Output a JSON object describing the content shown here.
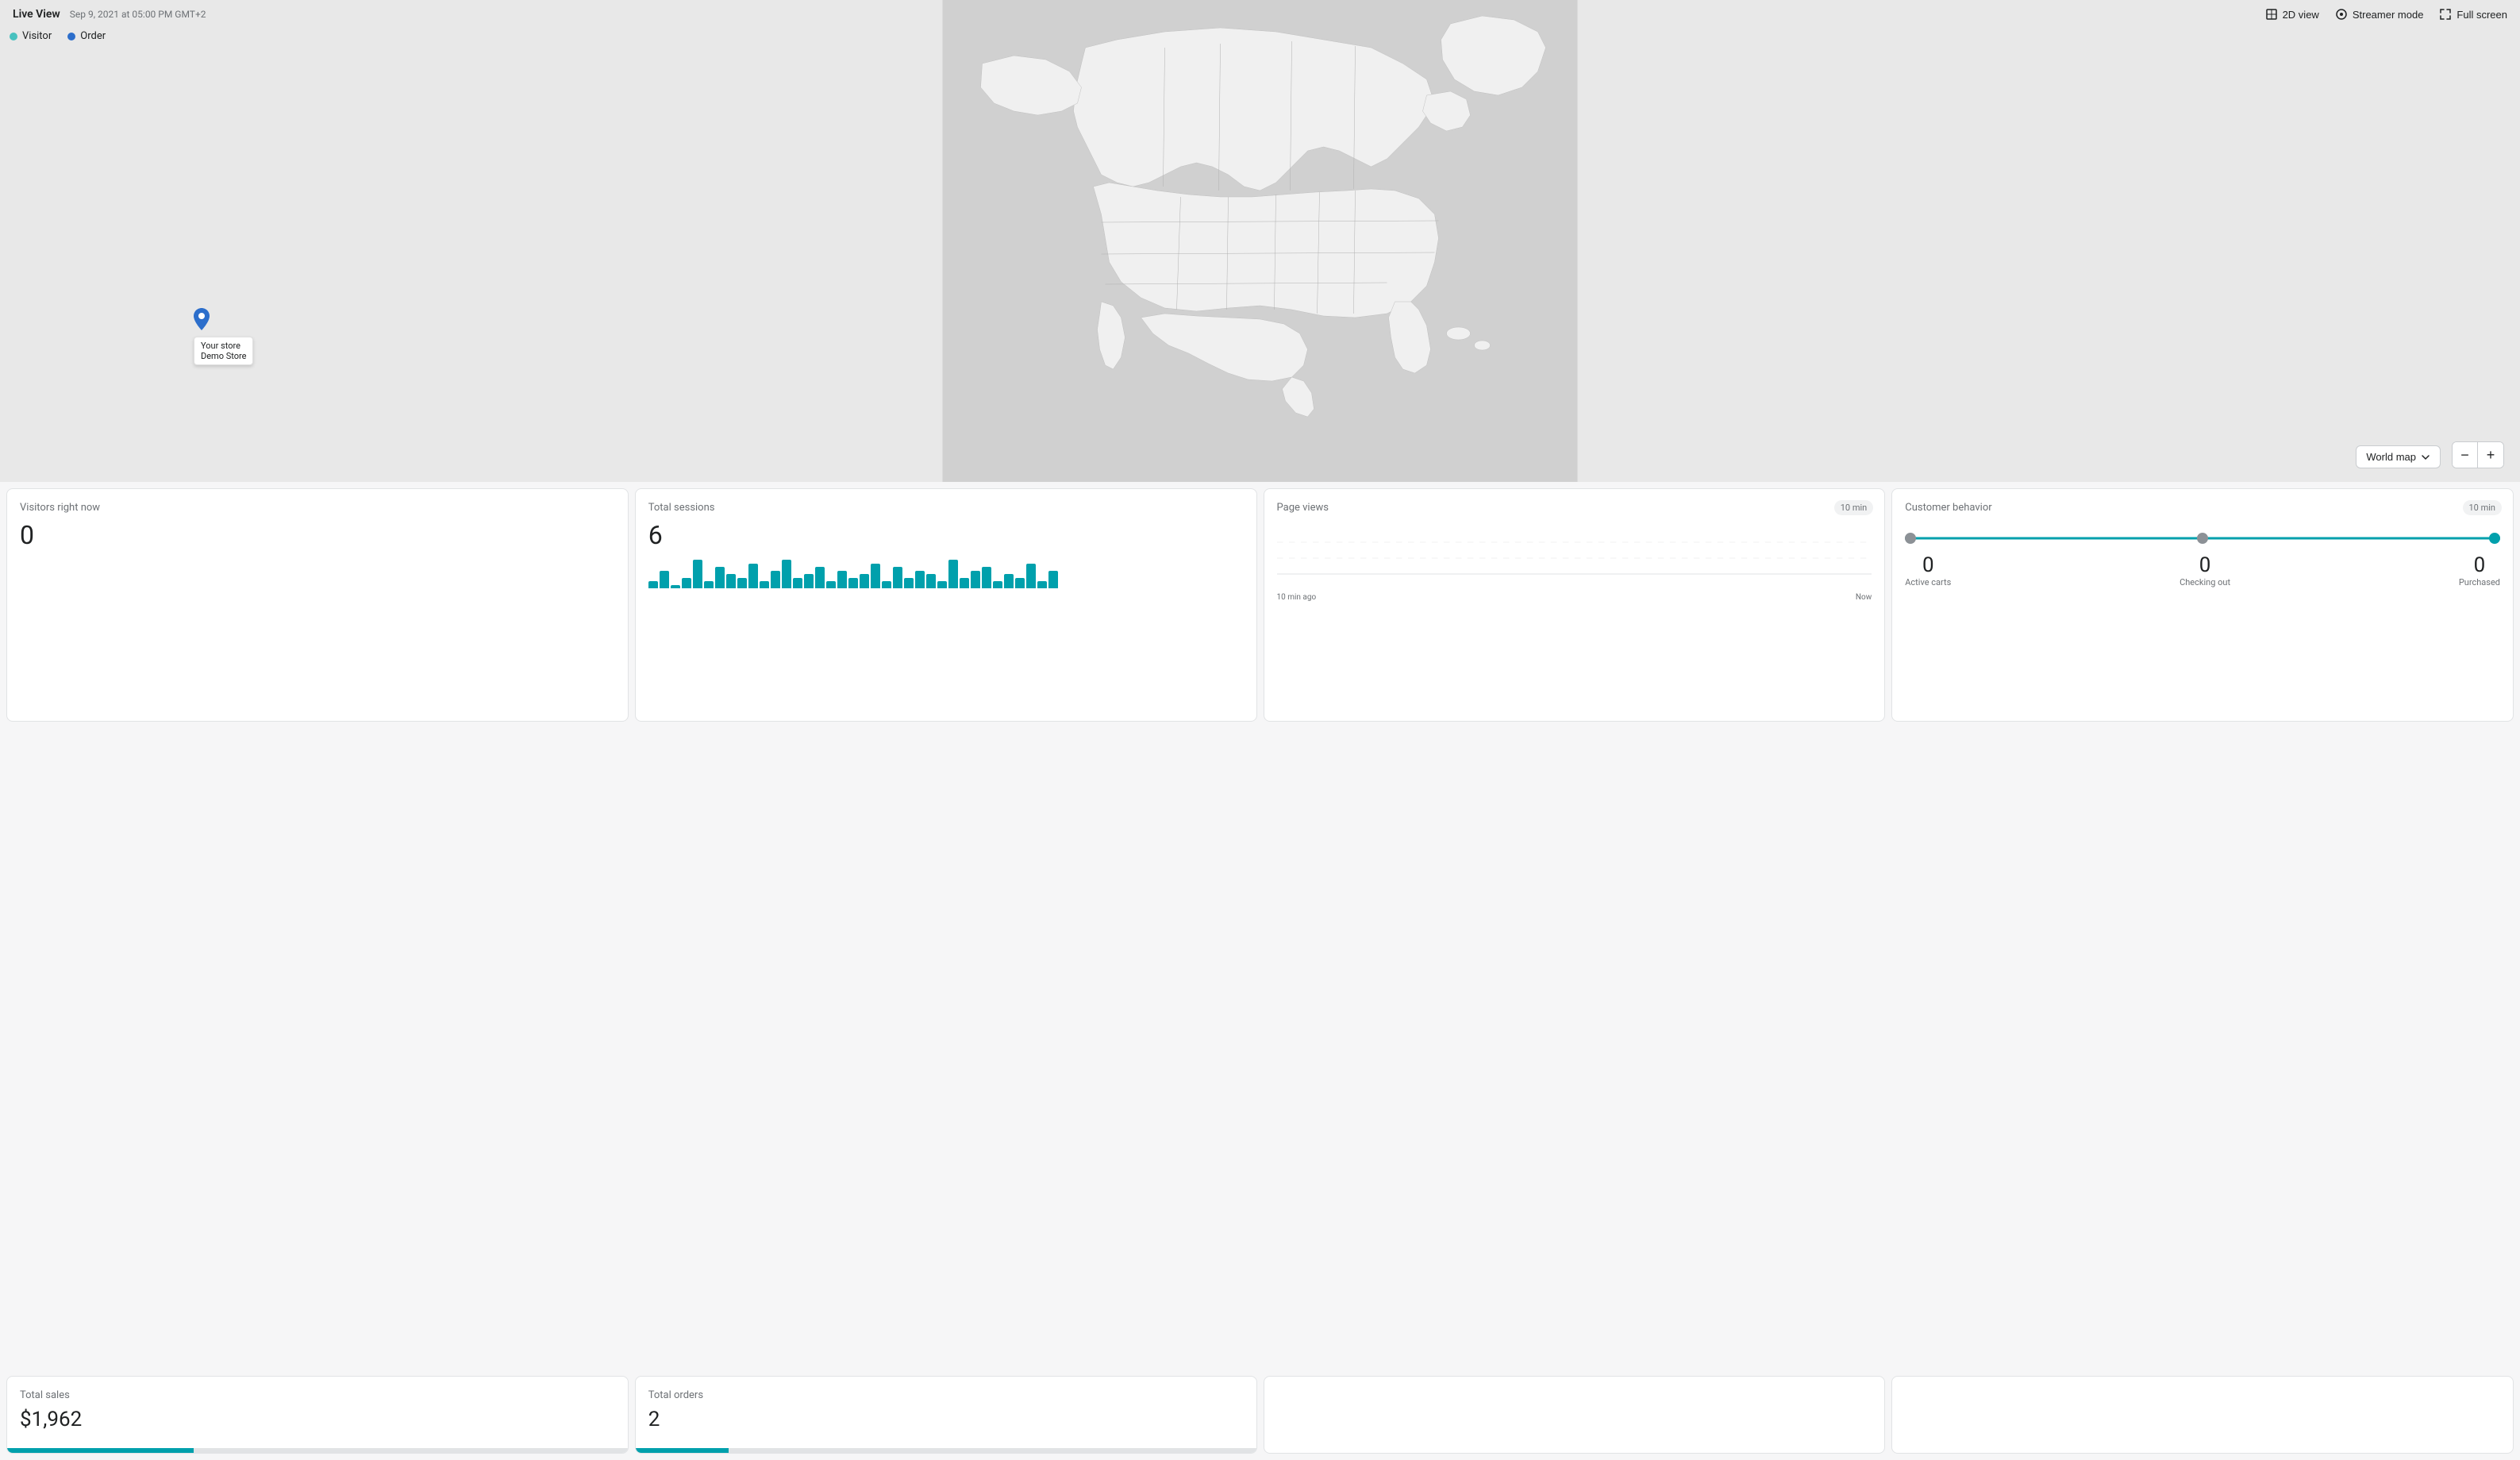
{
  "header": {
    "title": "Live View",
    "date": "Sep 9, 2021 at 05:00 PM GMT+2",
    "buttons": {
      "twoD": "2D view",
      "streamer": "Streamer mode",
      "fullscreen": "Full screen"
    }
  },
  "legend": {
    "visitor_label": "Visitor",
    "order_label": "Order",
    "visitor_color": "#47c1bf",
    "order_color": "#2c6ecb"
  },
  "map": {
    "world_map_label": "World map",
    "zoom_in": "+",
    "zoom_out": "−"
  },
  "store_pin": {
    "label_line1": "Your store",
    "label_line2": "Demo Store"
  },
  "stats": {
    "visitors_right_now": {
      "label": "Visitors right now",
      "value": "0"
    },
    "total_sessions": {
      "label": "Total sessions",
      "value": "6"
    },
    "page_views": {
      "label": "Page views",
      "badge": "10 min",
      "time_start": "10 min ago",
      "time_end": "Now"
    },
    "customer_behavior": {
      "label": "Customer behavior",
      "badge": "10 min",
      "active_carts_label": "Active carts",
      "active_carts_value": "0",
      "checking_out_label": "Checking out",
      "checking_out_value": "0",
      "purchased_label": "Purchased",
      "purchased_value": "0"
    },
    "total_sales": {
      "label": "Total sales",
      "value": "$1,962"
    },
    "total_orders": {
      "label": "Total orders",
      "value": "2"
    }
  },
  "session_bars": [
    2,
    5,
    1,
    3,
    8,
    2,
    6,
    4,
    3,
    7,
    2,
    5,
    8,
    3,
    4,
    6,
    2,
    5,
    3,
    4,
    7,
    2,
    6,
    3,
    5,
    4,
    2,
    8,
    3,
    5,
    6,
    2,
    4,
    3,
    7,
    2,
    5
  ]
}
